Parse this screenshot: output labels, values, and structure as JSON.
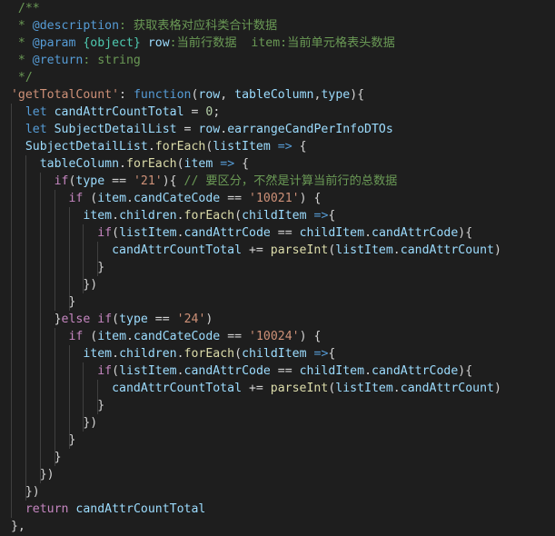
{
  "editor": {
    "theme": "dark",
    "background": "#1e1e1e",
    "lines": [
      [
        {
          "t": "  /**",
          "c": "comment"
        }
      ],
      [
        {
          "t": "  * ",
          "c": "comment"
        },
        {
          "t": "@description",
          "c": "tag"
        },
        {
          "t": ": 获取表格对应科类合计数据",
          "c": "comment"
        }
      ],
      [
        {
          "t": "  * ",
          "c": "comment"
        },
        {
          "t": "@param",
          "c": "tag"
        },
        {
          "t": " ",
          "c": "comment"
        },
        {
          "t": "{object}",
          "c": "type"
        },
        {
          "t": " ",
          "c": "comment"
        },
        {
          "t": "row",
          "c": "param"
        },
        {
          "t": ":当前行数据  item:当前单元格表头数据",
          "c": "comment"
        }
      ],
      [
        {
          "t": "  * ",
          "c": "comment"
        },
        {
          "t": "@return",
          "c": "tag"
        },
        {
          "t": ": string",
          "c": "comment"
        }
      ],
      [
        {
          "t": "  */",
          "c": "comment"
        }
      ],
      [
        {
          "t": " ",
          "c": "punc"
        },
        {
          "t": "'getTotalCount'",
          "c": "key"
        },
        {
          "t": ": ",
          "c": "punc"
        },
        {
          "t": "function",
          "c": "kw"
        },
        {
          "t": "(",
          "c": "punc"
        },
        {
          "t": "row",
          "c": "param"
        },
        {
          "t": ", ",
          "c": "punc"
        },
        {
          "t": "tableColumn",
          "c": "param"
        },
        {
          "t": ",",
          "c": "punc"
        },
        {
          "t": "type",
          "c": "param"
        },
        {
          "t": "){",
          "c": "punc"
        }
      ],
      [
        {
          "t": "   ",
          "c": "punc"
        },
        {
          "t": "let",
          "c": "kw"
        },
        {
          "t": " ",
          "c": "punc"
        },
        {
          "t": "candAttrCountTotal",
          "c": "var"
        },
        {
          "t": " = ",
          "c": "op"
        },
        {
          "t": "0",
          "c": "num"
        },
        {
          "t": ";",
          "c": "punc"
        }
      ],
      [
        {
          "t": "   ",
          "c": "punc"
        },
        {
          "t": "let",
          "c": "kw"
        },
        {
          "t": " ",
          "c": "punc"
        },
        {
          "t": "SubjectDetailList",
          "c": "var"
        },
        {
          "t": " = ",
          "c": "op"
        },
        {
          "t": "row",
          "c": "var"
        },
        {
          "t": ".",
          "c": "punc"
        },
        {
          "t": "earrangeCandPerInfoDTOs",
          "c": "var"
        }
      ],
      [
        {
          "t": "   ",
          "c": "punc"
        },
        {
          "t": "SubjectDetailList",
          "c": "var"
        },
        {
          "t": ".",
          "c": "punc"
        },
        {
          "t": "forEach",
          "c": "fn"
        },
        {
          "t": "(",
          "c": "punc"
        },
        {
          "t": "listItem",
          "c": "param"
        },
        {
          "t": " ",
          "c": "punc"
        },
        {
          "t": "=>",
          "c": "kw"
        },
        {
          "t": " {",
          "c": "punc"
        }
      ],
      [
        {
          "t": "     ",
          "c": "punc"
        },
        {
          "t": "tableColumn",
          "c": "var"
        },
        {
          "t": ".",
          "c": "punc"
        },
        {
          "t": "forEach",
          "c": "fn"
        },
        {
          "t": "(",
          "c": "punc"
        },
        {
          "t": "item",
          "c": "param"
        },
        {
          "t": " ",
          "c": "punc"
        },
        {
          "t": "=>",
          "c": "kw"
        },
        {
          "t": " {",
          "c": "punc"
        }
      ],
      [
        {
          "t": "       ",
          "c": "punc"
        },
        {
          "t": "if",
          "c": "ctrl"
        },
        {
          "t": "(",
          "c": "punc"
        },
        {
          "t": "type",
          "c": "var"
        },
        {
          "t": " == ",
          "c": "op"
        },
        {
          "t": "'21'",
          "c": "str"
        },
        {
          "t": "){ ",
          "c": "punc"
        },
        {
          "t": "// 要区分，不然是计算当前行的总数据",
          "c": "comment"
        }
      ],
      [
        {
          "t": "         ",
          "c": "punc"
        },
        {
          "t": "if",
          "c": "ctrl"
        },
        {
          "t": " (",
          "c": "punc"
        },
        {
          "t": "item",
          "c": "var"
        },
        {
          "t": ".",
          "c": "punc"
        },
        {
          "t": "candCateCode",
          "c": "var"
        },
        {
          "t": " == ",
          "c": "op"
        },
        {
          "t": "'10021'",
          "c": "str"
        },
        {
          "t": ") {",
          "c": "punc"
        }
      ],
      [
        {
          "t": "           ",
          "c": "punc"
        },
        {
          "t": "item",
          "c": "var"
        },
        {
          "t": ".",
          "c": "punc"
        },
        {
          "t": "children",
          "c": "var"
        },
        {
          "t": ".",
          "c": "punc"
        },
        {
          "t": "forEach",
          "c": "fn"
        },
        {
          "t": "(",
          "c": "punc"
        },
        {
          "t": "childItem",
          "c": "param"
        },
        {
          "t": " ",
          "c": "punc"
        },
        {
          "t": "=>",
          "c": "kw"
        },
        {
          "t": "{",
          "c": "punc"
        }
      ],
      [
        {
          "t": "             ",
          "c": "punc"
        },
        {
          "t": "if",
          "c": "ctrl"
        },
        {
          "t": "(",
          "c": "punc"
        },
        {
          "t": "listItem",
          "c": "var"
        },
        {
          "t": ".",
          "c": "punc"
        },
        {
          "t": "candAttrCode",
          "c": "var"
        },
        {
          "t": " == ",
          "c": "op"
        },
        {
          "t": "childItem",
          "c": "var"
        },
        {
          "t": ".",
          "c": "punc"
        },
        {
          "t": "candAttrCode",
          "c": "var"
        },
        {
          "t": "){",
          "c": "punc"
        }
      ],
      [
        {
          "t": "               ",
          "c": "punc"
        },
        {
          "t": "candAttrCountTotal",
          "c": "var"
        },
        {
          "t": " += ",
          "c": "op"
        },
        {
          "t": "parseInt",
          "c": "fn"
        },
        {
          "t": "(",
          "c": "punc"
        },
        {
          "t": "listItem",
          "c": "var"
        },
        {
          "t": ".",
          "c": "punc"
        },
        {
          "t": "candAttrCount",
          "c": "var"
        },
        {
          "t": ")",
          "c": "punc"
        }
      ],
      [
        {
          "t": "             }",
          "c": "punc"
        }
      ],
      [
        {
          "t": "           })",
          "c": "punc"
        }
      ],
      [
        {
          "t": "         }",
          "c": "punc"
        }
      ],
      [
        {
          "t": "       }",
          "c": "punc"
        },
        {
          "t": "else",
          "c": "ctrl"
        },
        {
          "t": " ",
          "c": "punc"
        },
        {
          "t": "if",
          "c": "ctrl"
        },
        {
          "t": "(",
          "c": "punc"
        },
        {
          "t": "type",
          "c": "var"
        },
        {
          "t": " == ",
          "c": "op"
        },
        {
          "t": "'24'",
          "c": "str"
        },
        {
          "t": ")",
          "c": "punc"
        }
      ],
      [
        {
          "t": "         ",
          "c": "punc"
        },
        {
          "t": "if",
          "c": "ctrl"
        },
        {
          "t": " (",
          "c": "punc"
        },
        {
          "t": "item",
          "c": "var"
        },
        {
          "t": ".",
          "c": "punc"
        },
        {
          "t": "candCateCode",
          "c": "var"
        },
        {
          "t": " == ",
          "c": "op"
        },
        {
          "t": "'10024'",
          "c": "str"
        },
        {
          "t": ") {",
          "c": "punc"
        }
      ],
      [
        {
          "t": "           ",
          "c": "punc"
        },
        {
          "t": "item",
          "c": "var"
        },
        {
          "t": ".",
          "c": "punc"
        },
        {
          "t": "children",
          "c": "var"
        },
        {
          "t": ".",
          "c": "punc"
        },
        {
          "t": "forEach",
          "c": "fn"
        },
        {
          "t": "(",
          "c": "punc"
        },
        {
          "t": "childItem",
          "c": "param"
        },
        {
          "t": " ",
          "c": "punc"
        },
        {
          "t": "=>",
          "c": "kw"
        },
        {
          "t": "{",
          "c": "punc"
        }
      ],
      [
        {
          "t": "             ",
          "c": "punc"
        },
        {
          "t": "if",
          "c": "ctrl"
        },
        {
          "t": "(",
          "c": "punc"
        },
        {
          "t": "listItem",
          "c": "var"
        },
        {
          "t": ".",
          "c": "punc"
        },
        {
          "t": "candAttrCode",
          "c": "var"
        },
        {
          "t": " == ",
          "c": "op"
        },
        {
          "t": "childItem",
          "c": "var"
        },
        {
          "t": ".",
          "c": "punc"
        },
        {
          "t": "candAttrCode",
          "c": "var"
        },
        {
          "t": "){",
          "c": "punc"
        }
      ],
      [
        {
          "t": "               ",
          "c": "punc"
        },
        {
          "t": "candAttrCountTotal",
          "c": "var"
        },
        {
          "t": " += ",
          "c": "op"
        },
        {
          "t": "parseInt",
          "c": "fn"
        },
        {
          "t": "(",
          "c": "punc"
        },
        {
          "t": "listItem",
          "c": "var"
        },
        {
          "t": ".",
          "c": "punc"
        },
        {
          "t": "candAttrCount",
          "c": "var"
        },
        {
          "t": ")",
          "c": "punc"
        }
      ],
      [
        {
          "t": "             }",
          "c": "punc"
        }
      ],
      [
        {
          "t": "           })",
          "c": "punc"
        }
      ],
      [
        {
          "t": "         }",
          "c": "punc"
        }
      ],
      [
        {
          "t": "       }",
          "c": "punc"
        }
      ],
      [
        {
          "t": "     })",
          "c": "punc"
        }
      ],
      [
        {
          "t": "   })",
          "c": "punc"
        }
      ],
      [
        {
          "t": "   ",
          "c": "punc"
        },
        {
          "t": "return",
          "c": "ctrl"
        },
        {
          "t": " ",
          "c": "punc"
        },
        {
          "t": "candAttrCountTotal",
          "c": "var"
        }
      ],
      [
        {
          "t": " },",
          "c": "punc"
        }
      ],
      [
        {
          "t": "},",
          "c": "punc"
        }
      ]
    ]
  }
}
